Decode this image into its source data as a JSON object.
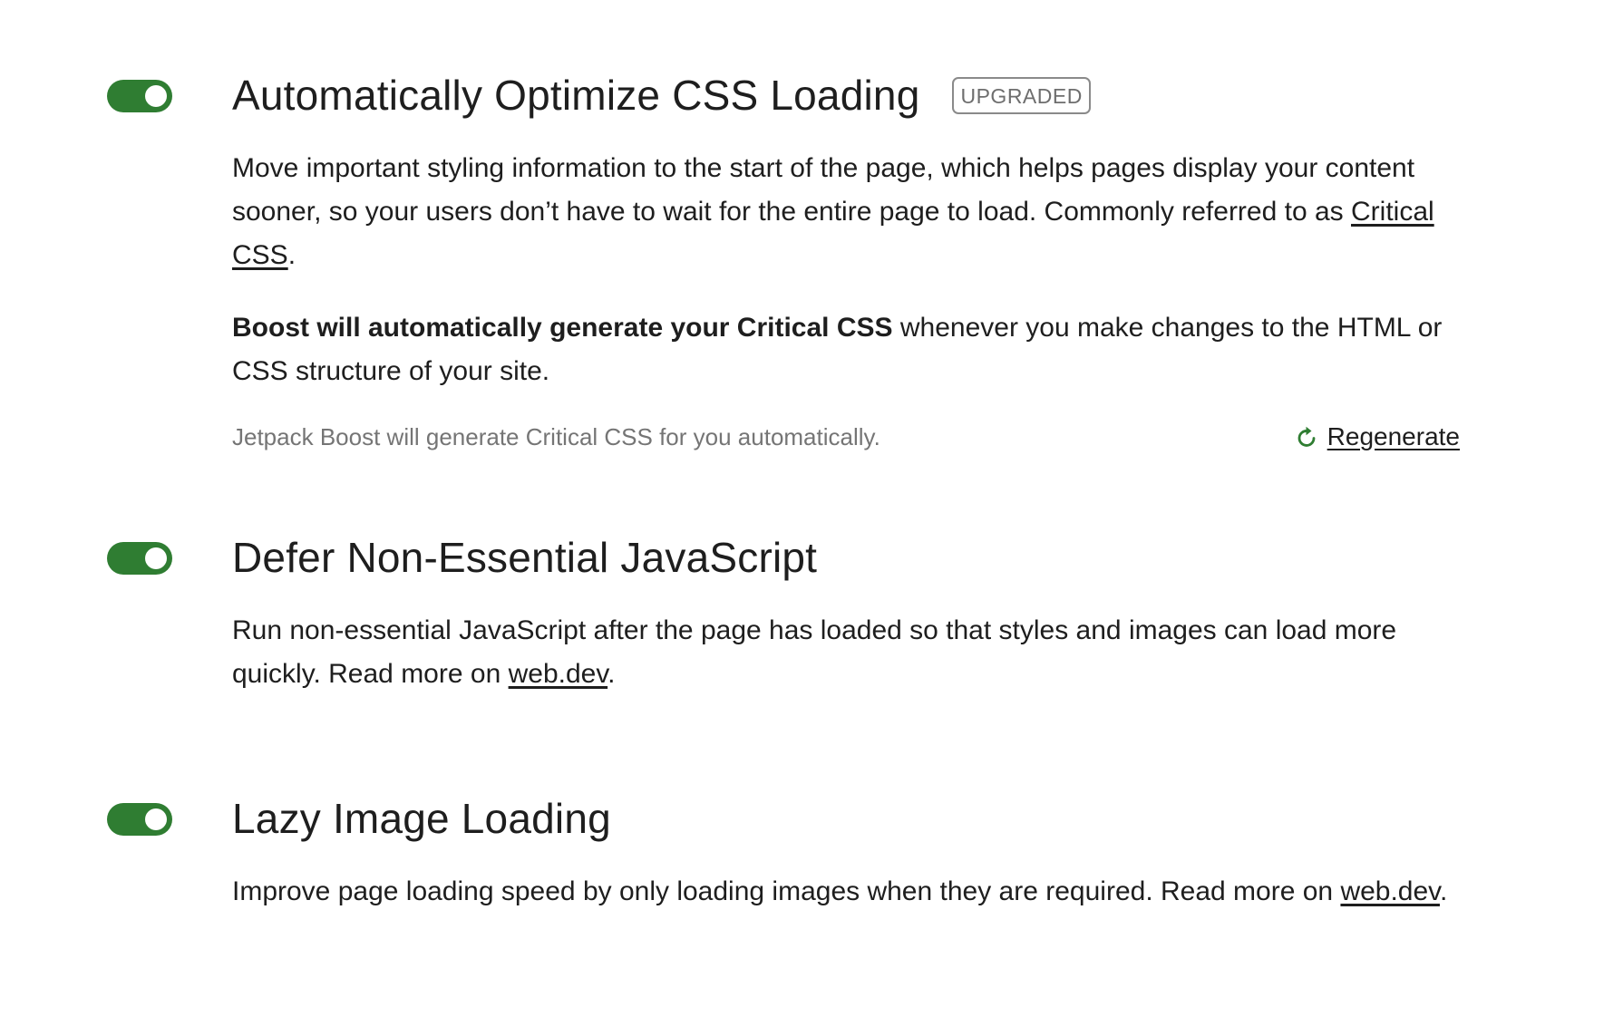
{
  "colors": {
    "accent": "#2f7d32",
    "text": "#1e1e1e",
    "muted": "#757575",
    "badge_border": "#8a8a8a"
  },
  "modules": {
    "css": {
      "enabled": true,
      "title": "Automatically Optimize CSS Loading",
      "badge": "UPGRADED",
      "desc1_pre": "Move important styling information to the start of the page, which helps pages display your content sooner, so your users don’t have to wait for the entire page to load. Commonly referred to as ",
      "desc1_link": "Critical CSS",
      "desc1_post": ".",
      "desc2_bold": "Boost will automatically generate your Critical CSS",
      "desc2_rest": " whenever you make changes to the HTML or CSS structure of your site.",
      "status": "Jetpack Boost will generate Critical CSS for you automatically.",
      "regenerate_label": "Regenerate",
      "regenerate_icon": "refresh-icon"
    },
    "js": {
      "enabled": true,
      "title": "Defer Non-Essential JavaScript",
      "desc_pre": "Run non-essential JavaScript after the page has loaded so that styles and images can load more quickly. Read more on ",
      "desc_link": "web.dev",
      "desc_post": "."
    },
    "lazy": {
      "enabled": true,
      "title": "Lazy Image Loading",
      "desc_pre": "Improve page loading speed by only loading images when they are required. Read more on ",
      "desc_link": "web.dev",
      "desc_post": "."
    }
  }
}
